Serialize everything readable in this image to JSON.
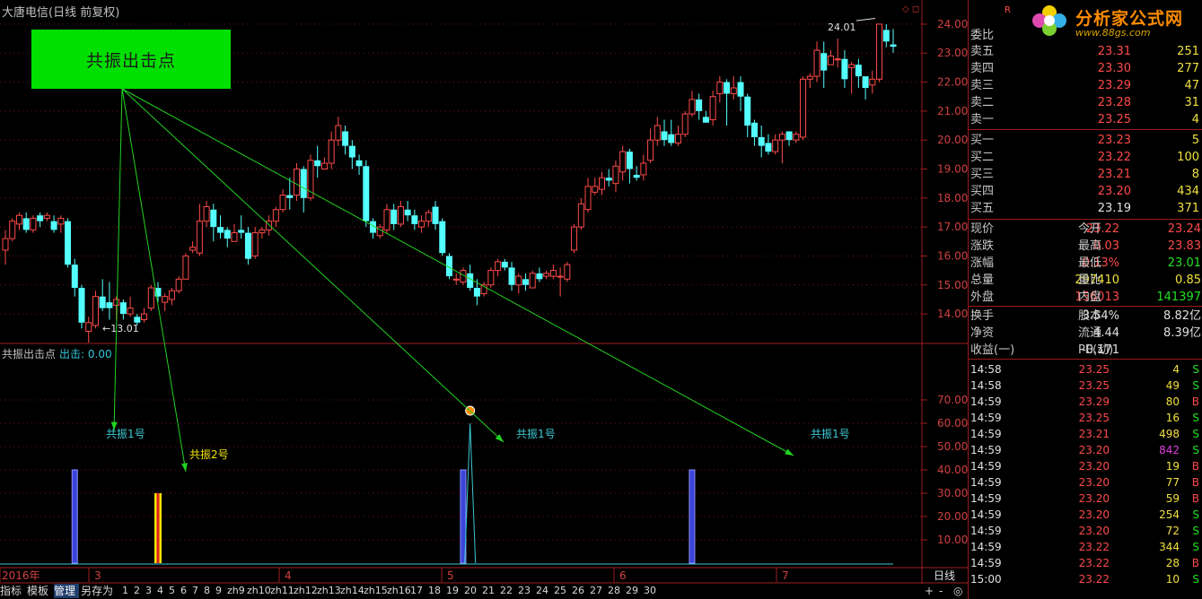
{
  "stock_title": "大唐电信(日线 前复权)",
  "banner_label": "共振出击点",
  "indicator": {
    "name": "共振出击点",
    "output": "出击: 0.00"
  },
  "annotations": {
    "high_label": "24.01",
    "low_label": "13.01"
  },
  "signals": [
    {
      "label": "共振1号",
      "color": "#3dc8d2"
    },
    {
      "label": "共振2号",
      "color": "#f4e400"
    },
    {
      "label": "共振1号",
      "color": "#3dc8d2"
    },
    {
      "label": "共振1号",
      "color": "#3dc8d2"
    }
  ],
  "bottom_tabs": [
    "指标",
    "模板",
    "管理",
    "另存为",
    "1",
    "2",
    "3",
    "4",
    "5",
    "6",
    "7",
    "8",
    "9",
    "zh9",
    "zh10",
    "zh11",
    "zh12",
    "zh13",
    "zh14",
    "zh15",
    "zh16",
    "17",
    "18",
    "19",
    "20",
    "21",
    "22",
    "23",
    "24",
    "25",
    "26",
    "27",
    "28",
    "29",
    "30"
  ],
  "bottom_right": {
    "period": "日线",
    "plus": "+",
    "minus": "-",
    "circle": "◎"
  },
  "chart_data": [
    {
      "type": "candlestick",
      "title": "大唐电信(日线 前复权)",
      "ylim": [
        13.6,
        24.4
      ],
      "y_ticks": [
        "24.00",
        "23.00",
        "22.00",
        "21.00",
        "20.00",
        "19.00",
        "18.00",
        "17.00",
        "16.00",
        "15.00",
        "14.00"
      ],
      "x_labels": [
        "2016年",
        "3",
        "4",
        "5",
        "6",
        "7"
      ],
      "marked_high": 24.01,
      "marked_low": 13.01,
      "candles": [
        [
          16.2,
          16.6,
          15.7,
          16.9
        ],
        [
          16.6,
          17.2,
          16.5,
          17.3
        ],
        [
          17.1,
          17.4,
          16.9,
          17.5
        ],
        [
          17.3,
          16.9,
          16.8,
          17.5
        ],
        [
          16.9,
          17.3,
          16.8,
          17.4
        ],
        [
          17.4,
          17.2,
          17.0,
          17.5
        ],
        [
          17.3,
          17.4,
          17.2,
          17.5
        ],
        [
          17.2,
          16.9,
          16.8,
          17.4
        ],
        [
          17.1,
          17.3,
          16.8,
          17.4
        ],
        [
          17.2,
          15.7,
          15.6,
          17.3
        ],
        [
          15.7,
          14.9,
          14.6,
          15.9
        ],
        [
          14.9,
          13.7,
          13.5,
          15.0
        ],
        [
          13.4,
          13.7,
          13.01,
          13.9
        ],
        [
          13.6,
          14.6,
          13.5,
          14.8
        ],
        [
          14.6,
          14.2,
          14.1,
          15.2
        ],
        [
          14.4,
          14.2,
          13.8,
          15.1
        ],
        [
          14.3,
          14.5,
          13.8,
          14.6
        ],
        [
          14.4,
          14.0,
          13.8,
          14.5
        ],
        [
          14.0,
          14.2,
          13.9,
          14.6
        ],
        [
          13.9,
          13.7,
          13.6,
          14.0
        ],
        [
          13.8,
          14.0,
          13.7,
          14.2
        ],
        [
          14.2,
          14.9,
          14.1,
          15.0
        ],
        [
          14.9,
          14.6,
          14.4,
          15.1
        ],
        [
          14.4,
          14.6,
          14.1,
          14.7
        ],
        [
          14.5,
          14.8,
          14.3,
          14.9
        ],
        [
          14.8,
          15.2,
          14.7,
          15.3
        ],
        [
          15.2,
          16.0,
          15.2,
          16.1
        ],
        [
          16.2,
          16.3,
          16.1,
          16.5
        ],
        [
          16.1,
          17.2,
          16.0,
          17.8
        ],
        [
          17.2,
          17.7,
          17.0,
          17.9
        ],
        [
          17.6,
          17.0,
          16.5,
          17.8
        ],
        [
          17.0,
          16.8,
          16.6,
          17.4
        ],
        [
          16.9,
          16.6,
          16.3,
          17.0
        ],
        [
          16.5,
          16.8,
          16.5,
          17.1
        ],
        [
          16.9,
          16.8,
          16.6,
          17.4
        ],
        [
          16.8,
          15.9,
          15.7,
          17.0
        ],
        [
          16.0,
          16.8,
          15.9,
          17.0
        ],
        [
          16.8,
          16.9,
          16.6,
          17.0
        ],
        [
          16.9,
          17.2,
          16.7,
          17.4
        ],
        [
          17.2,
          17.6,
          17.0,
          17.7
        ],
        [
          17.6,
          18.1,
          17.5,
          18.3
        ],
        [
          18.1,
          18.0,
          17.6,
          18.7
        ],
        [
          18.1,
          19.0,
          17.9,
          19.2
        ],
        [
          19.0,
          18.0,
          17.5,
          19.1
        ],
        [
          18.0,
          19.3,
          17.9,
          19.5
        ],
        [
          19.3,
          19.1,
          18.7,
          19.8
        ],
        [
          19.0,
          19.2,
          19.0,
          19.4
        ],
        [
          19.2,
          20.0,
          19.0,
          20.3
        ],
        [
          20.0,
          20.5,
          19.8,
          20.8
        ],
        [
          20.3,
          19.8,
          19.5,
          20.5
        ],
        [
          19.8,
          19.4,
          19.0,
          20.0
        ],
        [
          19.3,
          19.1,
          18.8,
          19.5
        ],
        [
          19.1,
          17.2,
          17.0,
          19.3
        ],
        [
          17.2,
          16.8,
          16.6,
          17.3
        ],
        [
          16.7,
          17.0,
          16.6,
          17.1
        ],
        [
          16.9,
          17.6,
          16.8,
          17.8
        ],
        [
          17.6,
          17.1,
          16.9,
          17.8
        ],
        [
          17.1,
          17.7,
          17.0,
          17.9
        ],
        [
          17.6,
          17.4,
          17.2,
          17.9
        ],
        [
          17.4,
          17.1,
          16.9,
          17.6
        ],
        [
          17.0,
          17.2,
          16.8,
          17.4
        ],
        [
          17.2,
          17.5,
          17.0,
          17.6
        ],
        [
          17.7,
          17.1,
          16.9,
          17.9
        ],
        [
          17.2,
          16.1,
          16.0,
          17.3
        ],
        [
          16.0,
          15.3,
          15.2,
          16.1
        ],
        [
          15.2,
          15.2,
          15.0,
          15.4
        ],
        [
          15.1,
          15.5,
          15.0,
          15.6
        ],
        [
          15.4,
          14.9,
          14.8,
          15.7
        ],
        [
          14.9,
          14.6,
          14.3,
          15.2
        ],
        [
          14.7,
          15.0,
          14.6,
          15.1
        ],
        [
          15.0,
          15.5,
          14.9,
          15.6
        ],
        [
          15.5,
          15.8,
          15.3,
          15.9
        ],
        [
          15.8,
          15.6,
          15.5,
          15.9
        ],
        [
          15.6,
          15.0,
          14.8,
          15.8
        ],
        [
          15.0,
          15.3,
          14.7,
          15.4
        ],
        [
          15.2,
          15.0,
          14.8,
          15.4
        ],
        [
          14.9,
          15.4,
          14.9,
          15.5
        ],
        [
          15.4,
          15.2,
          15.1,
          15.6
        ],
        [
          15.3,
          15.4,
          15.2,
          15.5
        ],
        [
          15.3,
          15.5,
          15.2,
          15.7
        ],
        [
          15.3,
          15.3,
          14.6,
          15.6
        ],
        [
          15.2,
          15.7,
          15.1,
          15.8
        ],
        [
          16.2,
          17.0,
          16.1,
          17.1
        ],
        [
          17.0,
          17.8,
          16.9,
          18.0
        ],
        [
          17.6,
          18.4,
          17.5,
          18.7
        ],
        [
          18.2,
          18.4,
          18.1,
          18.7
        ],
        [
          18.3,
          18.7,
          18.1,
          18.9
        ],
        [
          18.7,
          18.6,
          18.4,
          19.0
        ],
        [
          18.5,
          19.1,
          18.2,
          19.3
        ],
        [
          18.9,
          19.6,
          18.6,
          19.8
        ],
        [
          19.6,
          19.0,
          18.5,
          19.7
        ],
        [
          18.8,
          18.7,
          18.6,
          19.1
        ],
        [
          18.8,
          19.2,
          18.6,
          19.5
        ],
        [
          19.3,
          20.0,
          19.2,
          20.4
        ],
        [
          20.0,
          20.5,
          19.8,
          20.8
        ],
        [
          20.3,
          20.0,
          19.8,
          20.7
        ],
        [
          20.2,
          19.9,
          19.8,
          20.7
        ],
        [
          19.9,
          20.2,
          19.8,
          20.5
        ],
        [
          20.2,
          20.9,
          20.1,
          21.0
        ],
        [
          20.9,
          21.4,
          20.8,
          21.7
        ],
        [
          21.4,
          21.0,
          20.7,
          21.6
        ],
        [
          20.8,
          20.6,
          20.6,
          21.0
        ],
        [
          20.7,
          21.5,
          20.5,
          21.7
        ],
        [
          21.6,
          22.0,
          21.3,
          22.2
        ],
        [
          22.0,
          21.6,
          20.5,
          22.1
        ],
        [
          21.6,
          21.8,
          21.4,
          22.2
        ],
        [
          22.0,
          21.5,
          21.0,
          22.2
        ],
        [
          21.5,
          20.5,
          20.1,
          21.6
        ],
        [
          20.6,
          20.1,
          19.8,
          20.7
        ],
        [
          20.1,
          19.8,
          19.4,
          20.5
        ],
        [
          19.9,
          19.6,
          19.5,
          20.2
        ],
        [
          19.6,
          20.0,
          19.5,
          20.2
        ],
        [
          20.0,
          20.2,
          19.2,
          20.3
        ],
        [
          20.3,
          20.0,
          19.8,
          20.3
        ],
        [
          20.0,
          20.2,
          19.9,
          20.3
        ],
        [
          20.1,
          22.1,
          20.0,
          22.2
        ],
        [
          22.1,
          22.2,
          21.8,
          22.3
        ],
        [
          22.2,
          23.1,
          22.0,
          23.4
        ],
        [
          23.0,
          22.4,
          21.8,
          23.4
        ],
        [
          22.6,
          22.9,
          22.6,
          23.1
        ],
        [
          22.8,
          22.8,
          22.5,
          23.5
        ],
        [
          22.8,
          22.1,
          21.8,
          23.1
        ],
        [
          22.5,
          22.6,
          21.6,
          22.7
        ],
        [
          22.6,
          22.2,
          21.8,
          22.8
        ],
        [
          22.2,
          21.8,
          21.4,
          22.2
        ],
        [
          21.9,
          22.1,
          21.6,
          22.4
        ],
        [
          22.1,
          24.0,
          22.0,
          24.01
        ],
        [
          23.8,
          23.4,
          23.2,
          24.0
        ],
        [
          23.3,
          23.22,
          23.01,
          23.83
        ]
      ]
    },
    {
      "type": "bar",
      "title": "共振出击点",
      "ylim": [
        0,
        80
      ],
      "y_ticks": [
        "70.00",
        "60.00",
        "50.00",
        "40.00",
        "30.00",
        "20.00",
        "10.00"
      ],
      "series": [
        {
          "name": "共振1号",
          "bars": [
            {
              "index": 10,
              "value": 40
            },
            {
              "index": 66,
              "value": 40
            },
            {
              "index": 99,
              "value": 40
            }
          ]
        },
        {
          "name": "共振2号",
          "bars": [
            {
              "index": 22,
              "value": 30
            }
          ]
        }
      ],
      "spike": {
        "index": 67,
        "value": 60
      },
      "output": "出击: 0.00"
    }
  ],
  "quote_panel": {
    "logo_text": "分析家公式网",
    "logo_url": "www.88gs.com",
    "header": "委比",
    "asks": [
      {
        "label": "卖五",
        "price": "23.31",
        "vol": "251"
      },
      {
        "label": "卖四",
        "price": "23.30",
        "vol": "277"
      },
      {
        "label": "卖三",
        "price": "23.29",
        "vol": "47"
      },
      {
        "label": "卖二",
        "price": "23.28",
        "vol": "31"
      },
      {
        "label": "卖一",
        "price": "23.25",
        "vol": "4"
      }
    ],
    "bids": [
      {
        "label": "买一",
        "price": "23.23",
        "vol": "5"
      },
      {
        "label": "买二",
        "price": "23.22",
        "vol": "100"
      },
      {
        "label": "买三",
        "price": "23.21",
        "vol": "8"
      },
      {
        "label": "买四",
        "price": "23.20",
        "vol": "434"
      },
      {
        "label": "买五",
        "price": "23.19",
        "vol": "371"
      }
    ],
    "stats": [
      {
        "l1": "现价",
        "v1": "23.22",
        "l2": "今开",
        "v2": "23.24"
      },
      {
        "l1": "涨跌",
        "v1": "0.03",
        "l2": "最高",
        "v2": "23.83"
      },
      {
        "l1": "涨幅",
        "v1": "0.13%",
        "l2": "最低",
        "v2": "23.01"
      },
      {
        "l1": "总量",
        "v1": "297410",
        "l2": "量比",
        "v2": "0.85"
      },
      {
        "l1": "外盘",
        "v1": "156013",
        "l2": "内盘",
        "v2": "141397"
      }
    ],
    "stats2": [
      {
        "l1": "换手",
        "v1": "3.54%",
        "l2": "股本",
        "v2": "8.82亿"
      },
      {
        "l1": "净资",
        "v1": "4.44",
        "l2": "流通",
        "v2": "8.39亿"
      },
      {
        "l1": "收益(一)",
        "v1": "-0.171",
        "l2": "PE(动)",
        "v2": ""
      }
    ],
    "ticks": [
      {
        "time": "14:58",
        "price": "23.25",
        "vol": "4",
        "side": "S"
      },
      {
        "time": "14:58",
        "price": "23.25",
        "vol": "49",
        "side": "S"
      },
      {
        "time": "14:59",
        "price": "23.29",
        "vol": "80",
        "side": "B"
      },
      {
        "time": "14:59",
        "price": "23.25",
        "vol": "16",
        "side": "S"
      },
      {
        "time": "14:59",
        "price": "23.21",
        "vol": "498",
        "side": "S"
      },
      {
        "time": "14:59",
        "price": "23.20",
        "vol": "842",
        "side": "S"
      },
      {
        "time": "14:59",
        "price": "23.20",
        "vol": "19",
        "side": "B"
      },
      {
        "time": "14:59",
        "price": "23.20",
        "vol": "77",
        "side": "B"
      },
      {
        "time": "14:59",
        "price": "23.20",
        "vol": "59",
        "side": "B"
      },
      {
        "time": "14:59",
        "price": "23.20",
        "vol": "254",
        "side": "S"
      },
      {
        "time": "14:59",
        "price": "23.20",
        "vol": "72",
        "side": "S"
      },
      {
        "time": "14:59",
        "price": "23.22",
        "vol": "344",
        "side": "S"
      },
      {
        "time": "14:59",
        "price": "23.22",
        "vol": "28",
        "side": "B"
      },
      {
        "time": "15:00",
        "price": "23.22",
        "vol": "10",
        "side": "S"
      }
    ]
  },
  "colors": {
    "up": "#ff4a4a",
    "down": "#54ffff",
    "grid": "#7a1010",
    "frame": "#a02020",
    "blue_bar": "#3a44d8",
    "green_arrow": "#22d322"
  }
}
